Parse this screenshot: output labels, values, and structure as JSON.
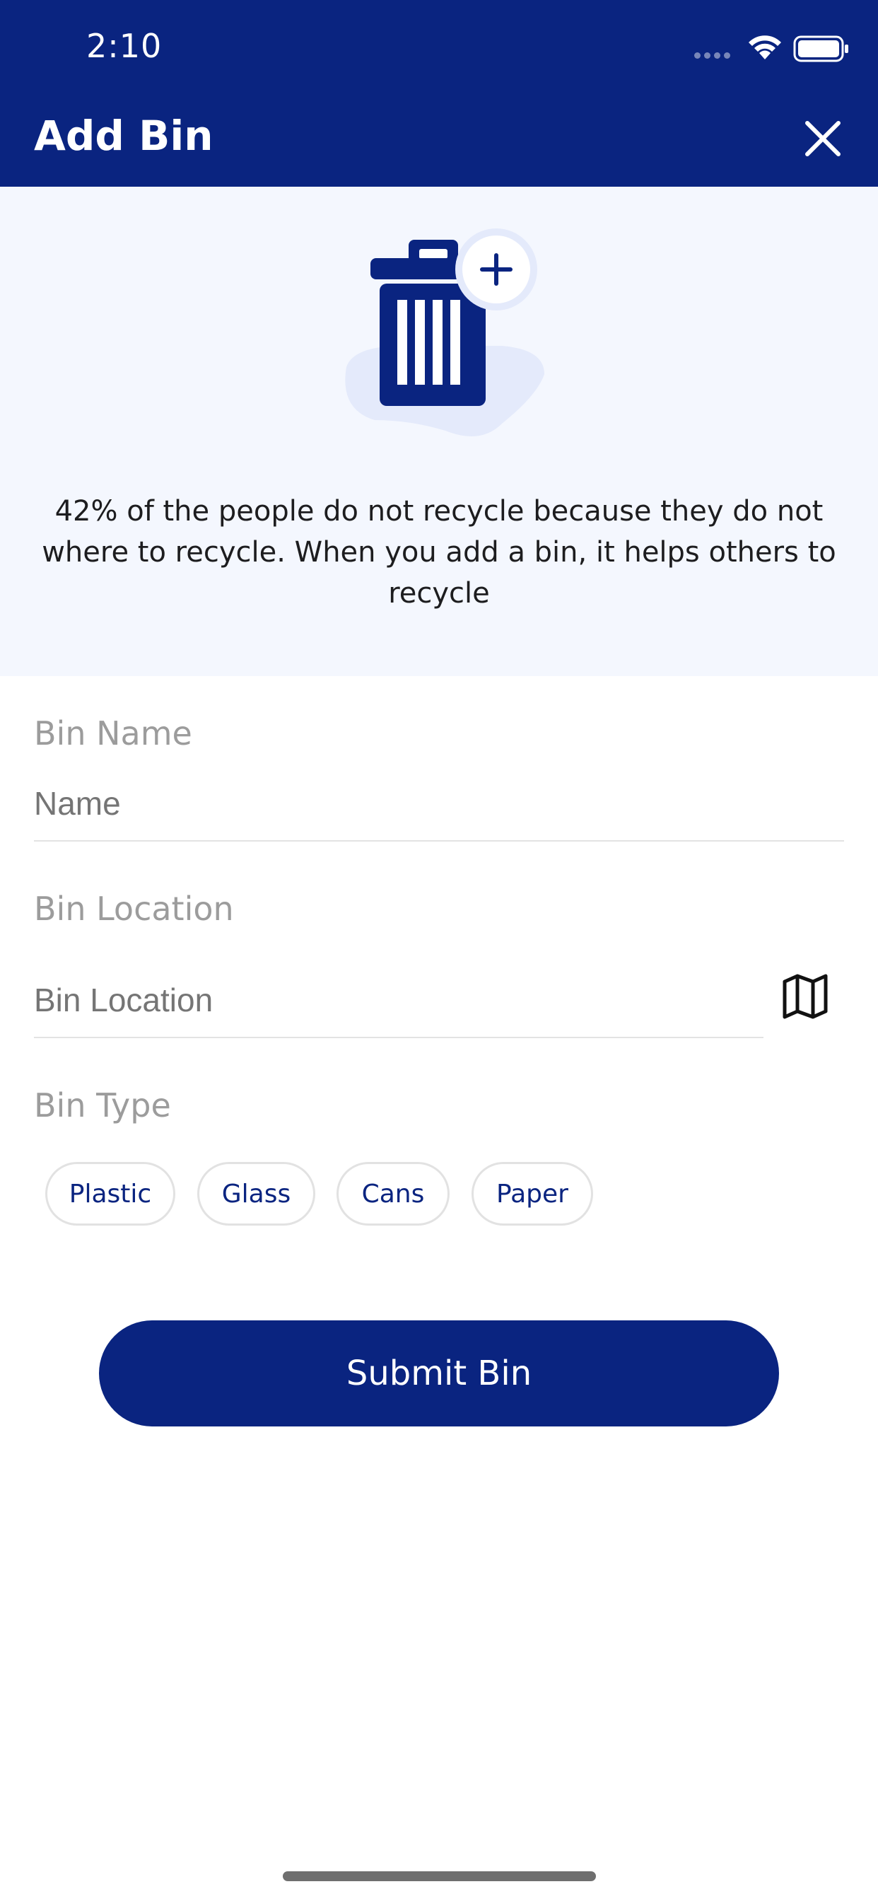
{
  "status_bar": {
    "time": "2:10",
    "icons": [
      "signal-icon",
      "wifi-icon",
      "battery-icon"
    ]
  },
  "header": {
    "title": "Add Bin",
    "close_icon": "close-icon"
  },
  "banner": {
    "illustration_icon": "trash-bin-add-icon",
    "text": "42% of the people do not recycle because they do not where to recycle. When you add a bin, it helps others to recycle"
  },
  "form": {
    "bin_name": {
      "label": "Bin Name",
      "placeholder": "Name",
      "value": ""
    },
    "bin_location": {
      "label": "Bin Location",
      "placeholder": "Bin Location",
      "value": "",
      "map_icon": "map-icon"
    },
    "bin_type": {
      "label": "Bin Type",
      "options": [
        "Plastic",
        "Glass",
        "Cans",
        "Paper"
      ]
    }
  },
  "submit": {
    "label": "Submit Bin"
  },
  "colors": {
    "primary": "#0a2480",
    "banner_bg": "#f4f7fe",
    "label_gray": "#9c9c9c",
    "placeholder_gray": "#c2c2c2"
  }
}
